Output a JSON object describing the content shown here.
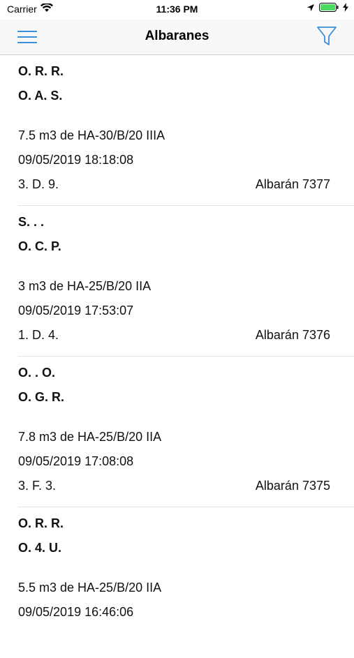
{
  "status_bar": {
    "carrier": "Carrier",
    "time": "11:36 PM",
    "icons": [
      "wifi-icon",
      "location-arrow-icon",
      "battery-icon",
      "charging-bolt-icon"
    ],
    "battery_color": "#4cd964"
  },
  "nav": {
    "title": "Albaranes",
    "menu_icon": "hamburger-menu-icon",
    "filter_icon": "filter-funnel-icon",
    "accent_color": "#3a8fd9"
  },
  "deliveries": [
    {
      "line1": "O. R. R.",
      "line2": "O. A. S.",
      "product": "7.5 m3 de HA-30/B/20 IIIA",
      "datetime": "09/05/2019 18:18:08",
      "code": "3. D. 9.",
      "albaran": "Albarán 7377"
    },
    {
      "line1": "S.  .  .",
      "line2": "O. C. P.",
      "product": "3 m3 de HA-25/B/20 IIA",
      "datetime": "09/05/2019 17:53:07",
      "code": "1. D. 4.",
      "albaran": "Albarán 7376"
    },
    {
      "line1": "O.  . O.",
      "line2": "O. G. R.",
      "product": "7.8 m3 de HA-25/B/20 IIA",
      "datetime": "09/05/2019 17:08:08",
      "code": "3. F. 3.",
      "albaran": "Albarán 7375"
    },
    {
      "line1": "O. R. R.",
      "line2": "O. 4. U.",
      "product": "5.5 m3 de HA-25/B/20 IIA",
      "datetime": "09/05/2019 16:46:06",
      "code": "",
      "albaran": ""
    }
  ]
}
